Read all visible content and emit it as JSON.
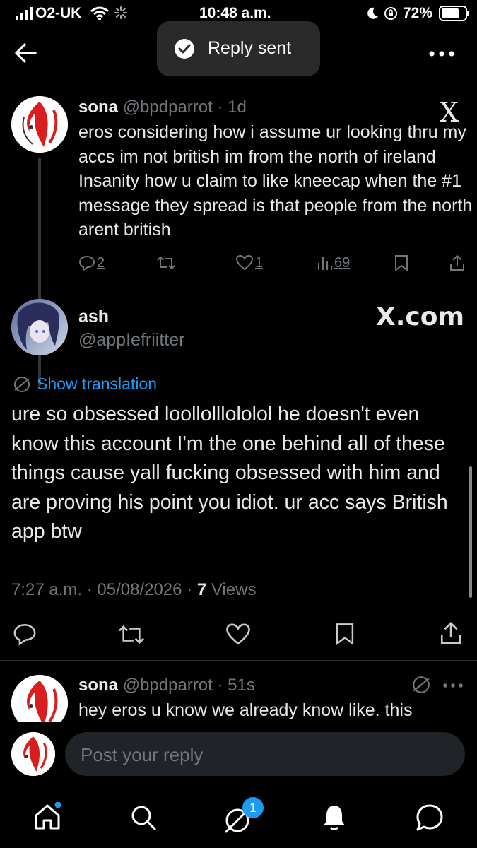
{
  "status_bar": {
    "carrier": "O2-UK",
    "time": "10:48 a.m.",
    "battery": "72%"
  },
  "header": {
    "toast": "Reply sent"
  },
  "parent_tweet": {
    "name": "sona",
    "handle": "@bpdparrot",
    "age": "· 1d",
    "text": "eros considering how i assume ur looking thru my accs im not british im from the north of ireland Insanity how u claim to like kneecap when the #1 message they spread is that people from the north arent british",
    "replies": "2",
    "likes": "1",
    "views": "69"
  },
  "main_tweet": {
    "name": "ash",
    "handle": "@appIefriitter",
    "translate": "Show translation",
    "text": "ure so obsessed loollolllololol he doesn't even know this account I'm the one behind all of these things cause yall fucking obsessed with him and are proving his point you idiot. ur acc says British app btw",
    "time": "7:27 a.m. · 05/08/2026 · ",
    "views_count": "7",
    "views_label": " Views"
  },
  "watermark": {
    "x_logo": "X",
    "x_com": "X.com"
  },
  "reply_tweet": {
    "name": "sona",
    "handle": "@bpdparrot",
    "age": "· 51s",
    "text": "hey eros u know we already know like. this"
  },
  "composer": {
    "placeholder": "Post your reply"
  },
  "bottom_nav": {
    "messages_badge": "1"
  }
}
